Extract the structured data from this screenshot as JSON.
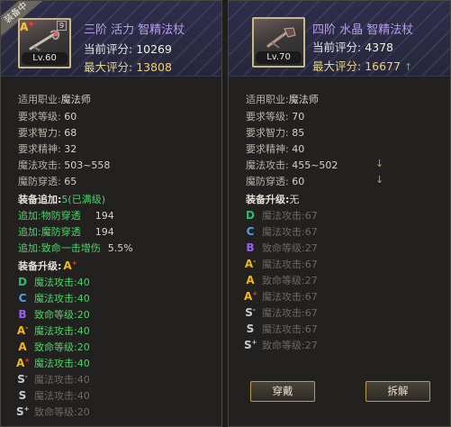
{
  "equipped": {
    "badge": "装备中",
    "slot": "9",
    "level": "Lv.60",
    "grade_text": "A",
    "grade_sup": "+",
    "name": "三阶 活力 智精法杖",
    "current_score_label": "当前评分:",
    "current_score": "10269",
    "max_score_label": "最大评分:",
    "max_score": "13808",
    "stats": [
      {
        "label": "适用职业:",
        "value": "魔法师"
      },
      {
        "label": "要求等级:",
        "value": "60"
      },
      {
        "label": "要求智力:",
        "value": "68"
      },
      {
        "label": "要求精神:",
        "value": "32"
      },
      {
        "label": "魔法攻击:",
        "value": "503~558"
      },
      {
        "label": "魔防穿透:",
        "value": "65"
      }
    ],
    "addon_title": "装备追加:",
    "addon_count": "5",
    "addon_status": "(已满级)",
    "addons": [
      {
        "label": "追加:物防穿透",
        "value": "194"
      },
      {
        "label": "追加:魔防穿透",
        "value": "194"
      },
      {
        "label": "追加:致命一击增伤",
        "value": "5.5%"
      }
    ],
    "upgrade_title": "装备升级:",
    "upgrade_grade": "A",
    "upgrade_grade_sup": "+",
    "upgrades": [
      {
        "grade": "D",
        "sup": "",
        "text": "魔法攻击:40",
        "active": true
      },
      {
        "grade": "C",
        "sup": "",
        "text": "魔法攻击:40",
        "active": true
      },
      {
        "grade": "B",
        "sup": "",
        "text": "致命等级:20",
        "active": true
      },
      {
        "grade": "A",
        "sup": "-",
        "text": "魔法攻击:40",
        "active": true
      },
      {
        "grade": "A",
        "sup": "",
        "text": "致命等级:20",
        "active": true
      },
      {
        "grade": "A",
        "sup": "+",
        "text": "魔法攻击:40",
        "active": true
      },
      {
        "grade": "S",
        "sup": "-",
        "text": "魔法攻击:40",
        "active": false
      },
      {
        "grade": "S",
        "sup": "",
        "text": "魔法攻击:40",
        "active": false
      },
      {
        "grade": "S",
        "sup": "+",
        "text": "致命等级:20",
        "active": false
      }
    ]
  },
  "compare": {
    "level": "Lv.70",
    "name": "四阶 水晶 智精法杖",
    "current_score_label": "当前评分:",
    "current_score": "4378",
    "max_score_label": "最大评分:",
    "max_score": "16677",
    "max_arrow": "↑",
    "stats": [
      {
        "label": "适用职业:",
        "value": "魔法师"
      },
      {
        "label": "要求等级:",
        "value": "70"
      },
      {
        "label": "要求智力:",
        "value": "85"
      },
      {
        "label": "要求精神:",
        "value": "40"
      },
      {
        "label": "魔法攻击:",
        "value": "455~502"
      },
      {
        "label": "魔防穿透:",
        "value": "60"
      }
    ],
    "down_arrow": "↓",
    "upgrade_title": "装备升级:",
    "upgrade_status": "无",
    "upgrades": [
      {
        "grade": "D",
        "sup": "",
        "text": "魔法攻击:67"
      },
      {
        "grade": "C",
        "sup": "",
        "text": "魔法攻击:67"
      },
      {
        "grade": "B",
        "sup": "",
        "text": "致命等级:27"
      },
      {
        "grade": "A",
        "sup": "-",
        "text": "魔法攻击:67"
      },
      {
        "grade": "A",
        "sup": "",
        "text": "致命等级:27"
      },
      {
        "grade": "A",
        "sup": "+",
        "text": "魔法攻击:67"
      },
      {
        "grade": "S",
        "sup": "-",
        "text": "魔法攻击:67"
      },
      {
        "grade": "S",
        "sup": "",
        "text": "魔法攻击:67"
      },
      {
        "grade": "S",
        "sup": "+",
        "text": "致命等级:27"
      }
    ],
    "equip_button": "穿戴",
    "dismantle_button": "拆解"
  }
}
